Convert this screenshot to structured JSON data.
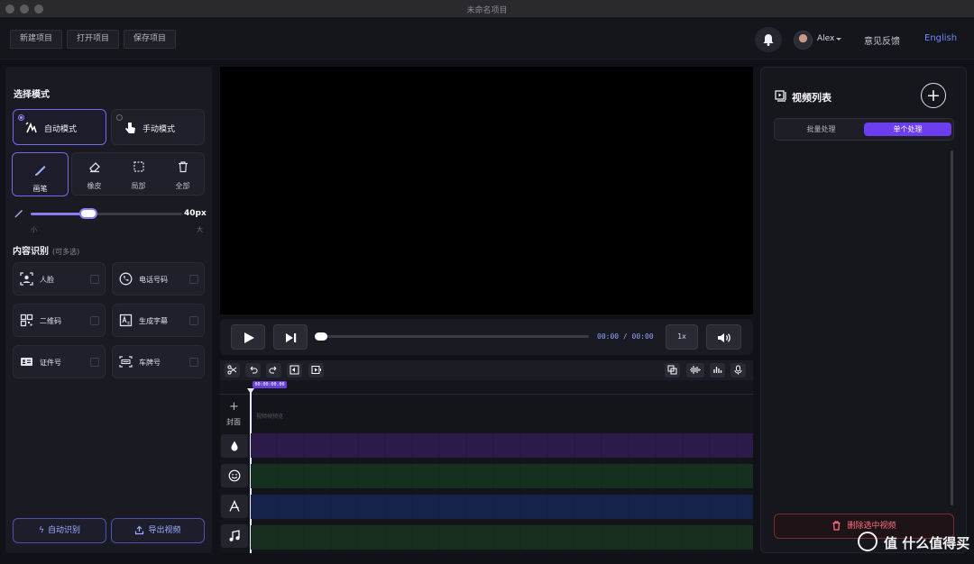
{
  "window": {
    "title": "未命名项目"
  },
  "toolbar": {
    "new_project": "新建项目",
    "open_project": "打开项目",
    "save_project": "保存项目"
  },
  "user": {
    "name": "Alex",
    "feedback": "意见反馈",
    "language": "English"
  },
  "left_panel": {
    "mode_title": "选择模式",
    "auto_mode": "自动模式",
    "manual_mode": "手动模式",
    "tools": {
      "brush": "画笔",
      "eraser": "橡皮",
      "partial": "局部",
      "all": "全部"
    },
    "brush_size": {
      "value": "40px",
      "min_label": "小",
      "max_label": "大",
      "level_fraction": 0.38
    },
    "content_title": "内容识别",
    "content_subtitle": "(可多选)",
    "content_items": [
      "人脸",
      "电话号码",
      "二维码",
      "生成字幕",
      "证件号",
      "车牌号"
    ],
    "auto_detect": "自动识别",
    "export_video": "导出视频"
  },
  "player": {
    "time": "00:00 / 00:00",
    "speed": "1x",
    "progress_fraction": 0
  },
  "timeline": {
    "playhead_time": "00:00:00.00",
    "cover_label": "封面",
    "preview_hint": "视频帧预览",
    "track_colors": [
      "#2b1a4a",
      "#16301f",
      "#16224a",
      "#182e1e"
    ]
  },
  "right_panel": {
    "title": "视频列表",
    "batch": "批量处理",
    "single": "单个处理",
    "delete_selected": "删除选中视频"
  },
  "watermark": {
    "text": "值 什么值得买"
  }
}
